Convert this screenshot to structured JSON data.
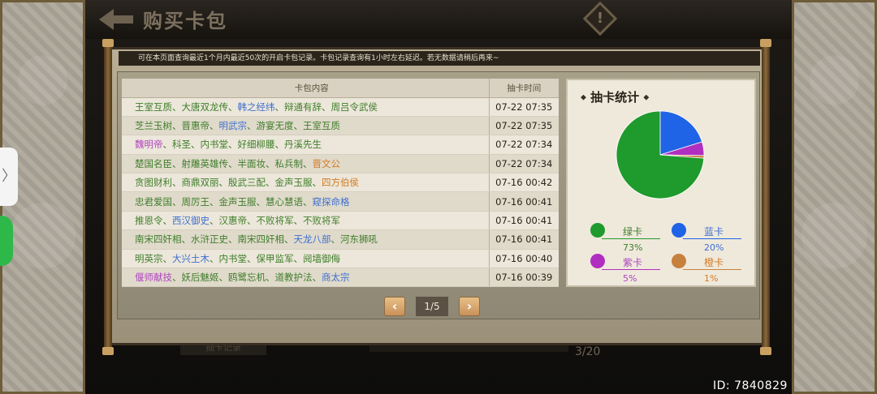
{
  "header": {
    "back_icon": "back-arrow-icon",
    "title": "购买卡包",
    "warning_icon": "warning-icon",
    "warning_glyph": "!"
  },
  "drawer": {
    "tab_glyph": "〉"
  },
  "dialog": {
    "notice": "可在本页面查询最近1个月内最近50次的开启卡包记录。卡包记录查询有1小时左右延迟。若无数据请稍后再来~",
    "table": {
      "col_content": "卡包内容",
      "col_time": "抽卡时间",
      "rows": [
        {
          "time": "07-22 07:35",
          "cards": [
            {
              "name": "王室互质",
              "rarity": "green"
            },
            {
              "name": "大唐双龙传",
              "rarity": "green"
            },
            {
              "name": "韩之经纬",
              "rarity": "blue"
            },
            {
              "name": "辩通有辞",
              "rarity": "green"
            },
            {
              "name": "周吕令武侯",
              "rarity": "green"
            }
          ]
        },
        {
          "time": "07-22 07:35",
          "cards": [
            {
              "name": "芝兰玉树",
              "rarity": "green"
            },
            {
              "name": "晋惠帝",
              "rarity": "green"
            },
            {
              "name": "明武宗",
              "rarity": "blue"
            },
            {
              "name": "游宴无度",
              "rarity": "green"
            },
            {
              "name": "王室互质",
              "rarity": "green"
            }
          ]
        },
        {
          "time": "07-22 07:34",
          "cards": [
            {
              "name": "魏明帝",
              "rarity": "purple"
            },
            {
              "name": "科圣",
              "rarity": "green"
            },
            {
              "name": "内书堂",
              "rarity": "green"
            },
            {
              "name": "好细柳腰",
              "rarity": "green"
            },
            {
              "name": "丹溪先生",
              "rarity": "green"
            }
          ]
        },
        {
          "time": "07-22 07:34",
          "cards": [
            {
              "name": "楚国名臣",
              "rarity": "green"
            },
            {
              "name": "射雕英雄传",
              "rarity": "green"
            },
            {
              "name": "半面妆",
              "rarity": "green"
            },
            {
              "name": "私兵制",
              "rarity": "green"
            },
            {
              "name": "晋文公",
              "rarity": "orange"
            }
          ]
        },
        {
          "time": "07-16 00:42",
          "cards": [
            {
              "name": "贪图财利",
              "rarity": "green"
            },
            {
              "name": "商鼎双丽",
              "rarity": "green"
            },
            {
              "name": "殷武三配",
              "rarity": "green"
            },
            {
              "name": "金声玉服",
              "rarity": "green"
            },
            {
              "name": "四方伯侯",
              "rarity": "orange"
            }
          ]
        },
        {
          "time": "07-16 00:41",
          "cards": [
            {
              "name": "忠君爱国",
              "rarity": "green"
            },
            {
              "name": "周厉王",
              "rarity": "green"
            },
            {
              "name": "金声玉服",
              "rarity": "green"
            },
            {
              "name": "慧心慧语",
              "rarity": "green"
            },
            {
              "name": "窥探命格",
              "rarity": "blue"
            }
          ]
        },
        {
          "time": "07-16 00:41",
          "cards": [
            {
              "name": "推恩令",
              "rarity": "green"
            },
            {
              "name": "西汉御史",
              "rarity": "blue"
            },
            {
              "name": "汉惠帝",
              "rarity": "green"
            },
            {
              "name": "不败将军",
              "rarity": "green"
            },
            {
              "name": "不败将军",
              "rarity": "green"
            }
          ]
        },
        {
          "time": "07-16 00:41",
          "cards": [
            {
              "name": "南宋四奸相",
              "rarity": "green"
            },
            {
              "name": "水浒正史",
              "rarity": "green"
            },
            {
              "name": "南宋四奸相",
              "rarity": "green"
            },
            {
              "name": "天龙八部",
              "rarity": "blue"
            },
            {
              "name": "河东狮吼",
              "rarity": "green"
            }
          ]
        },
        {
          "time": "07-16 00:40",
          "cards": [
            {
              "name": "明英宗",
              "rarity": "green"
            },
            {
              "name": "大兴土木",
              "rarity": "blue"
            },
            {
              "name": "内书堂",
              "rarity": "green"
            },
            {
              "name": "保甲监军",
              "rarity": "green"
            },
            {
              "name": "阋墙御侮",
              "rarity": "green"
            }
          ]
        },
        {
          "time": "07-16 00:39",
          "cards": [
            {
              "name": "偃师献技",
              "rarity": "purple"
            },
            {
              "name": "妖后魅姬",
              "rarity": "green"
            },
            {
              "name": "鸥鹭忘机",
              "rarity": "green"
            },
            {
              "name": "道教护法",
              "rarity": "green"
            },
            {
              "name": "商太宗",
              "rarity": "blue"
            }
          ]
        }
      ]
    },
    "stats": {
      "title": "抽卡统计",
      "title_marker": "◆",
      "legend": [
        {
          "key": "green",
          "label": "绿卡",
          "pct": "73%"
        },
        {
          "key": "blue",
          "label": "蓝卡",
          "pct": "20%"
        },
        {
          "key": "purple",
          "label": "紫卡",
          "pct": "5%"
        },
        {
          "key": "orange",
          "label": "橙卡",
          "pct": "1%"
        }
      ]
    },
    "pager": {
      "prev": "‹",
      "next": "›",
      "text": "1/5"
    }
  },
  "background": {
    "fragment_left": "抽卡记录",
    "page_indicator": "3/20"
  },
  "footer": {
    "id_text": "ID: 7840829"
  },
  "chart_data": {
    "type": "pie",
    "title": "抽卡统计",
    "categories": [
      "绿卡",
      "蓝卡",
      "紫卡",
      "橙卡"
    ],
    "values": [
      73,
      20,
      5,
      1
    ],
    "colors": [
      "#1f9a2c",
      "#1f63e6",
      "#b02fc0",
      "#c7813e"
    ]
  },
  "colors": {
    "green": "#3f7d2a",
    "blue": "#3e6fd0",
    "purple": "#b043c1",
    "orange": "#d37a23",
    "legend_green": "#1f9a2c",
    "legend_blue": "#1f63e6",
    "legend_purple": "#b02fc0",
    "legend_orange": "#c7813e"
  }
}
